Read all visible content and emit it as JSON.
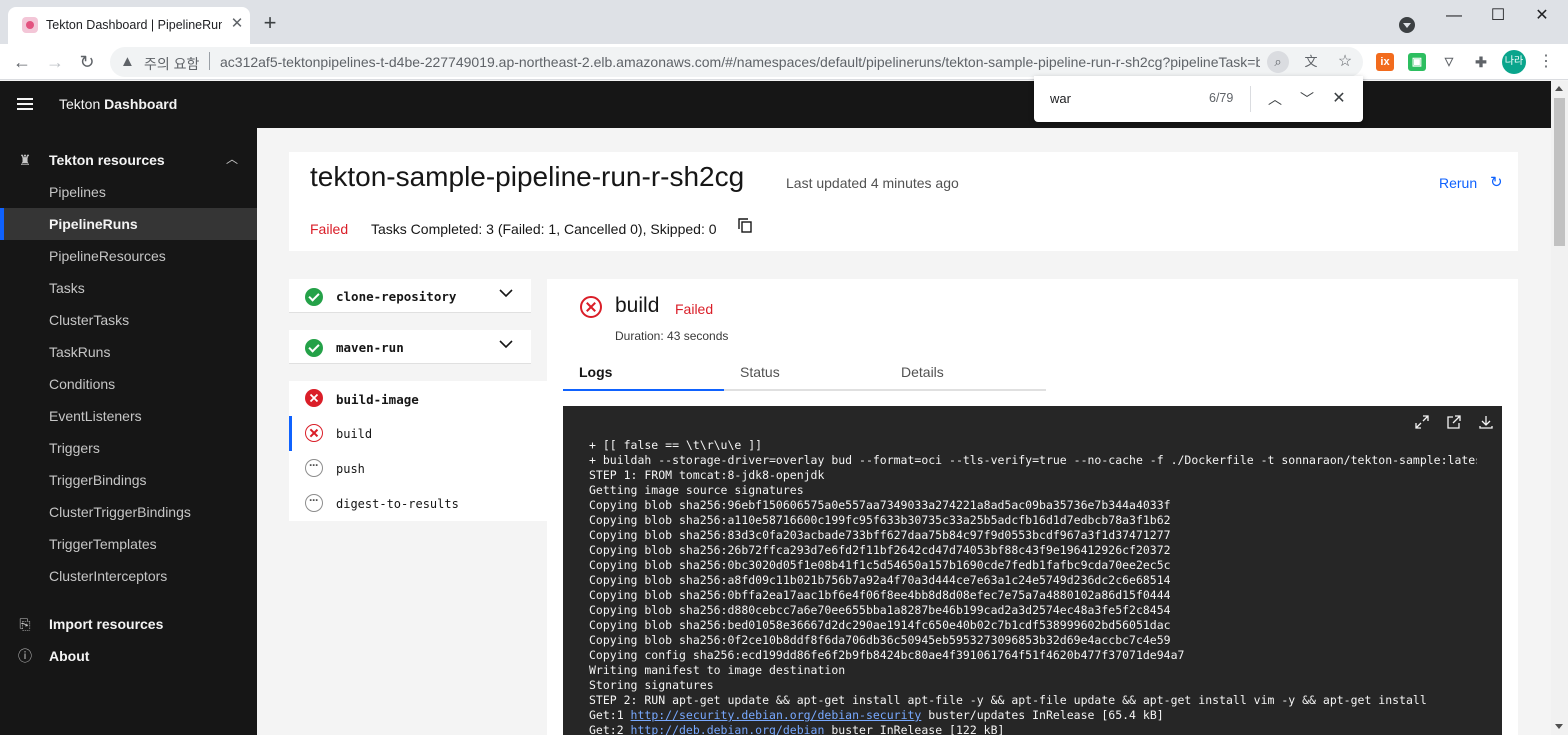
{
  "browser": {
    "tab_title": "Tekton Dashboard | PipelineRuns",
    "tab_close": "✕",
    "new_tab": "+",
    "window_minimize": "—",
    "window_maximize": "☐",
    "window_close": "✕",
    "security_label": "주의 요함",
    "url": "ac312af5-tektonpipelines-t-d4be-227749019.ap-northeast-2.elb.amazonaws.com/#/namespaces/default/pipelineruns/tekton-sample-pipeline-run-r-sh2cg?pipelineTask=build-image&step=build",
    "avatar_text": "나라"
  },
  "find_bar": {
    "query": "war",
    "count": "6/79"
  },
  "app": {
    "brand_prefix": "Tekton",
    "brand_bold": "Dashboard"
  },
  "sidebar": {
    "section_title": "Tekton resources",
    "items": [
      {
        "label": "Pipelines"
      },
      {
        "label": "PipelineRuns"
      },
      {
        "label": "PipelineResources"
      },
      {
        "label": "Tasks"
      },
      {
        "label": "ClusterTasks"
      },
      {
        "label": "TaskRuns"
      },
      {
        "label": "Conditions"
      },
      {
        "label": "EventListeners"
      },
      {
        "label": "Triggers"
      },
      {
        "label": "TriggerBindings"
      },
      {
        "label": "ClusterTriggerBindings"
      },
      {
        "label": "TriggerTemplates"
      },
      {
        "label": "ClusterInterceptors"
      }
    ],
    "import_label": "Import resources",
    "about_label": "About"
  },
  "run": {
    "title": "tekton-sample-pipeline-run-r-sh2cg",
    "last_updated": "Last updated 4 minutes ago",
    "rerun_label": "Rerun",
    "status": "Failed",
    "tasks_summary": "Tasks Completed: 3 (Failed: 1, Cancelled 0), Skipped: 0"
  },
  "tasks": {
    "clone": "clone-repository",
    "maven": "maven-run",
    "build_image": "build-image",
    "steps": [
      "build",
      "push",
      "digest-to-results"
    ]
  },
  "detail": {
    "title": "build",
    "status": "Failed",
    "duration": "Duration: 43 seconds",
    "tabs": [
      "Logs",
      "Status",
      "Details"
    ]
  },
  "logs": {
    "lines": [
      "+ [[ false == \\t\\r\\u\\e ]]",
      "+ buildah --storage-driver=overlay bud --format=oci --tls-verify=true --no-cache -f ./Dockerfile -t sonnaraon/tekton-sample:latest .",
      "STEP 1: FROM tomcat:8-jdk8-openjdk",
      "Getting image source signatures",
      "Copying blob sha256:96ebf150606575a0e557aa7349033a274221a8ad5ac09ba35736e7b344a4033f",
      "Copying blob sha256:a110e58716600c199fc95f633b30735c33a25b5adcfb16d1d7edbcb78a3f1b62",
      "Copying blob sha256:83d3c0fa203acbade733bff627daa75b84c97f9d0553bcdf967a3f1d37471277",
      "Copying blob sha256:26b72ffca293d7e6fd2f11bf2642cd47d74053bf88c43f9e196412926cf20372",
      "Copying blob sha256:0bc3020d05f1e08b41f1c5d54650a157b1690cde7fedb1fafbc9cda70ee2ec5c",
      "Copying blob sha256:a8fd09c11b021b756b7a92a4f70a3d444ce7e63a1c24e5749d236dc2c6e68514",
      "Copying blob sha256:0bffa2ea17aac1bf6e4f06f8ee4bb8d8d08efec7e75a7a4880102a86d15f0444",
      "Copying blob sha256:d880cebcc7a6e70ee655bba1a8287be46b199cad2a3d2574ec48a3fe5f2c8454",
      "Copying blob sha256:bed01058e36667d2dc290ae1914fc650e40b02c7b1cdf538999602bd56051dac",
      "Copying blob sha256:0f2ce10b8ddf8f6da706db36c50945eb5953273096853b32d69e4accbc7c4e59",
      "Copying config sha256:ecd199dd86fe6f2b9fb8424bc80ae4f391061764f51f4620b477f37071de94a7",
      "Writing manifest to image destination",
      "Storing signatures",
      "STEP 2: RUN apt-get update && apt-get install apt-file -y && apt-file update && apt-get install vim -y && apt-get install"
    ],
    "get1_prefix": "Get:1 ",
    "get1_link": "http://security.debian.org/debian-security",
    "get1_suffix": " buster/updates InRelease [65.4 kB]",
    "get2_prefix": "Get:2 ",
    "get2_link": "http://deb.debian.org/debian",
    "get2_suffix": " buster InRelease [122 kB]"
  }
}
